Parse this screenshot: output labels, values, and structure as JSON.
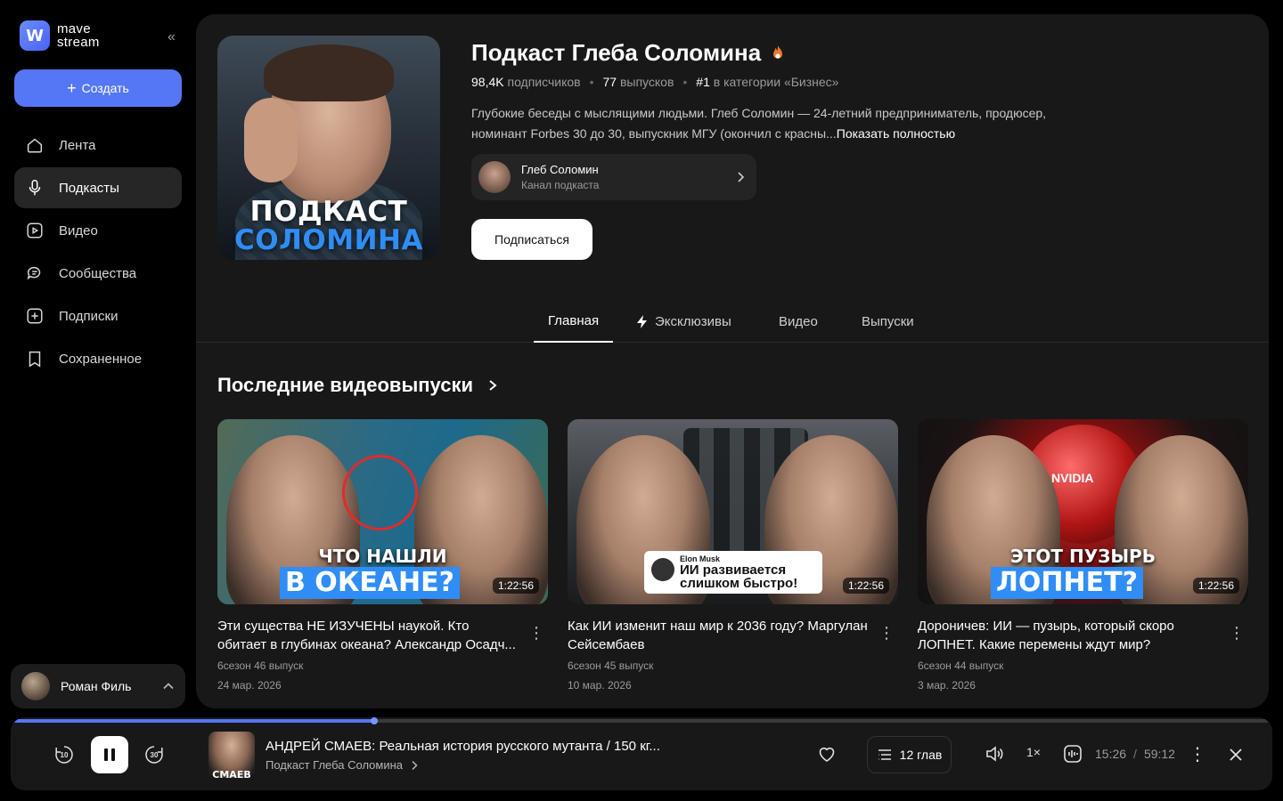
{
  "sidebar": {
    "logo_line1": "mave",
    "logo_line2": "stream",
    "logo_mark": "W",
    "collapse_icon": "«",
    "create_label": "Создать",
    "items": [
      {
        "label": "Лента",
        "icon": "home-icon"
      },
      {
        "label": "Подкасты",
        "icon": "microphone-icon",
        "active": true
      },
      {
        "label": "Видео",
        "icon": "video-icon"
      },
      {
        "label": "Сообщества",
        "icon": "chat-icon"
      },
      {
        "label": "Подписки",
        "icon": "plus-square-icon"
      },
      {
        "label": "Сохраненное",
        "icon": "bookmark-icon"
      }
    ],
    "user_name": "Роман Филь"
  },
  "podcast": {
    "cover_line1": "ПОДКАСТ",
    "cover_line2": "СОЛОМИНА",
    "title": "Подкаст Глеба Соломина",
    "subscribers_count": "98,4K",
    "subscribers_label": "подписчиков",
    "episodes_count": "77",
    "episodes_label": "выпусков",
    "rank": "#1",
    "rank_label": "в категории «Бизнес»",
    "description": "Глубокие беседы с мыслящими людьми. Глеб Соломин — 24-летний предприниматель, продюсер, номинант Forbes 30 до 30, выпускник МГУ (окончил с красны...",
    "show_more": "Показать полностью",
    "channel_name": "Глеб Соломин",
    "channel_sub": "Канал подкаста",
    "subscribe_label": "Подписаться"
  },
  "tabs": [
    {
      "label": "Главная",
      "active": true
    },
    {
      "label": "Эксклюзивы"
    },
    {
      "label": "Видео"
    },
    {
      "label": "Выпуски"
    }
  ],
  "section_title": "Последние видеовыпуски",
  "videos": [
    {
      "title": "Эти существа НЕ ИЗУЧЕНЫ наукой. Кто обитает в глубинах океана? Александр Осадч...",
      "meta": "6сезон 46 выпуск",
      "date": "24 мар. 2026",
      "duration": "1:22:56",
      "caption1": "ЧТО НАШЛИ",
      "caption2": "В ОКЕАНЕ?"
    },
    {
      "title": "Как ИИ изменит наш мир к 2036 году? Маргулан Сейсембаев",
      "meta": "6сезон 45 выпуск",
      "date": "10 мар. 2026",
      "duration": "1:22:56",
      "tweet_name": "Elon Musk",
      "tweet_text": "ИИ развивается слишком быстро!"
    },
    {
      "title": "Дороничев: ИИ — пузырь, который скоро ЛОПНЕТ. Какие перемены ждут мир?",
      "meta": "6сезон 44 выпуск",
      "date": "3 мар. 2026",
      "duration": "1:22:56",
      "caption1": "ЭТОТ ПУЗЫРЬ",
      "caption2": "ЛОПНЕТ?",
      "sphere_label": "NVIDIA"
    }
  ],
  "player": {
    "progress": 0.287,
    "episode_title": "АНДРЕЙ СМАЕВ: Реальная история русского мутанта / 150 кг...",
    "episode_art_text": "СМАЕВ",
    "podcast_name": "Подкаст Глеба Соломина",
    "chapters_label": "12 глав",
    "speed": "1×",
    "current_time": "15:26",
    "time_separator": "/",
    "total_time": "59:12",
    "rewind_seconds": "10",
    "forward_seconds": "30"
  },
  "colors": {
    "accent": "#5576f5",
    "panel": "#181818",
    "background": "#000000"
  }
}
